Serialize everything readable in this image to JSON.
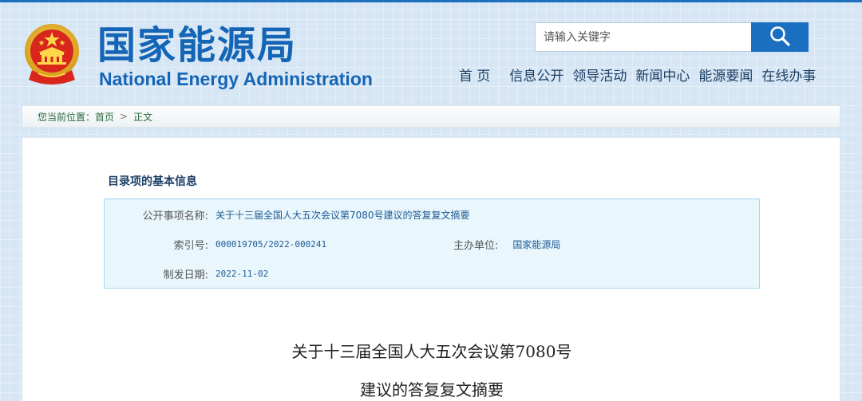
{
  "header": {
    "site_name_cn": "国家能源局",
    "site_name_en": "National Energy Administration",
    "emblem_icon": "national-emblem-icon"
  },
  "search": {
    "placeholder": "请输入关键字",
    "button_icon": "search-icon"
  },
  "nav": {
    "items": [
      "首 页",
      "信息公开",
      "领导活动",
      "新闻中心",
      "能源要闻",
      "在线办事"
    ]
  },
  "breadcrumb": {
    "prefix": "您当前位置：",
    "home": "首页",
    "separator": ">",
    "current": "正文"
  },
  "info": {
    "heading": "目录项的基本信息",
    "title_label": "公开事项名称:",
    "title_value": "关于十三届全国人大五次会议第7080号建议的答复复文摘要",
    "index_label": "索引号:",
    "index_value": "000019705/2022-000241",
    "org_label": "主办单位:",
    "org_value": "国家能源局",
    "date_label": "制发日期:",
    "date_value": "2022-11-02"
  },
  "document": {
    "title_line1": "关于十三届全国人大五次会议第7080号",
    "title_line2": "建议的答复复文摘要"
  },
  "colors": {
    "brand_blue": "#1565b6",
    "search_button": "#1a6fc0",
    "info_box_bg": "#e9f6fc",
    "info_box_border": "#a3d4ec",
    "page_bg": "#d6e6f4"
  }
}
